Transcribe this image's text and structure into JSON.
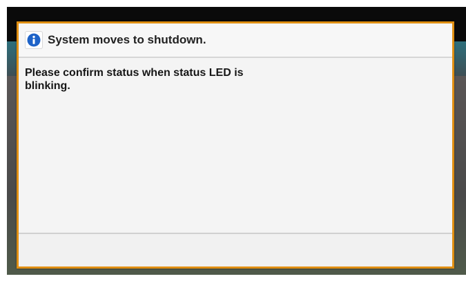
{
  "dialog": {
    "icon": "info-icon",
    "title": "System moves to shutdown.",
    "message": "Please confirm status when status LED is blinking.",
    "accent_color": "#e08f12",
    "icon_color": "#1e63c8"
  }
}
